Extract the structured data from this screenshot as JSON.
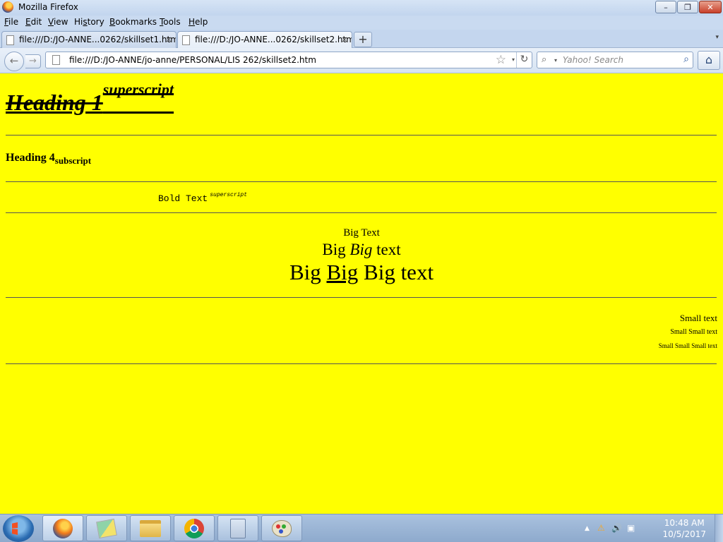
{
  "window": {
    "title": "Mozilla Firefox",
    "minimize_glyph": "–",
    "restore_glyph": "❐",
    "close_glyph": "✕"
  },
  "menu": {
    "items": [
      {
        "key": "F",
        "rest": "ile"
      },
      {
        "key": "E",
        "rest": "dit"
      },
      {
        "key": "V",
        "rest": "iew"
      },
      {
        "pre": "Hi",
        "key": "s",
        "rest": "tory"
      },
      {
        "key": "B",
        "rest": "ookmarks"
      },
      {
        "key": "T",
        "rest": "ools"
      },
      {
        "key": "H",
        "rest": "elp"
      }
    ]
  },
  "tabs": [
    {
      "label": "file:///D:/JO-ANNE...0262/skillset1.htm",
      "active": false
    },
    {
      "label": "file:///D:/JO-ANNE...0262/skillset2.htm",
      "active": true
    }
  ],
  "tab_close_glyph": "×",
  "new_tab_glyph": "+",
  "tab_list_glyph": "▾",
  "nav": {
    "back_glyph": "←",
    "forward_glyph": "→",
    "url": "file:///D:/JO-ANNE/jo-anne/PERSONAL/LIS 262/skillset2.htm",
    "bookmark_glyph": "☆",
    "dropdown_glyph": "▾",
    "reload_glyph": "↻",
    "search_engine_glyph": "⌕",
    "search_placeholder": "Yahoo! Search",
    "search_go_glyph": "⌕",
    "home_glyph": "⌂"
  },
  "page": {
    "heading1": "Heading 1",
    "heading1_sup": "superscript",
    "heading4": "Heading 4",
    "heading4_sub": "subscript",
    "bold_text": "Bold Text",
    "bold_text_sup": "superscript",
    "big_line1": "Big Text",
    "big_line2_a": "Big",
    "big_line2_b": "Big",
    "big_line2_c": "text",
    "big_line3_a": "Big",
    "big_line3_b": "Big",
    "big_line3_c": "Big text",
    "small_line1": "Small text",
    "small_line2": "Small Small text",
    "small_line3": "Small Small Small text"
  },
  "taskbar": {
    "apps": [
      "firefox-icon",
      "sticky-notes-icon",
      "file-explorer-icon",
      "chrome-icon",
      "calculator-icon",
      "paint-icon"
    ],
    "tray_arrow_glyph": "▲",
    "volume_glyph": "🔊",
    "network_glyph": "▣",
    "warning_glyph": "⚠",
    "time": "10:48 AM",
    "date": "10/5/2017"
  }
}
